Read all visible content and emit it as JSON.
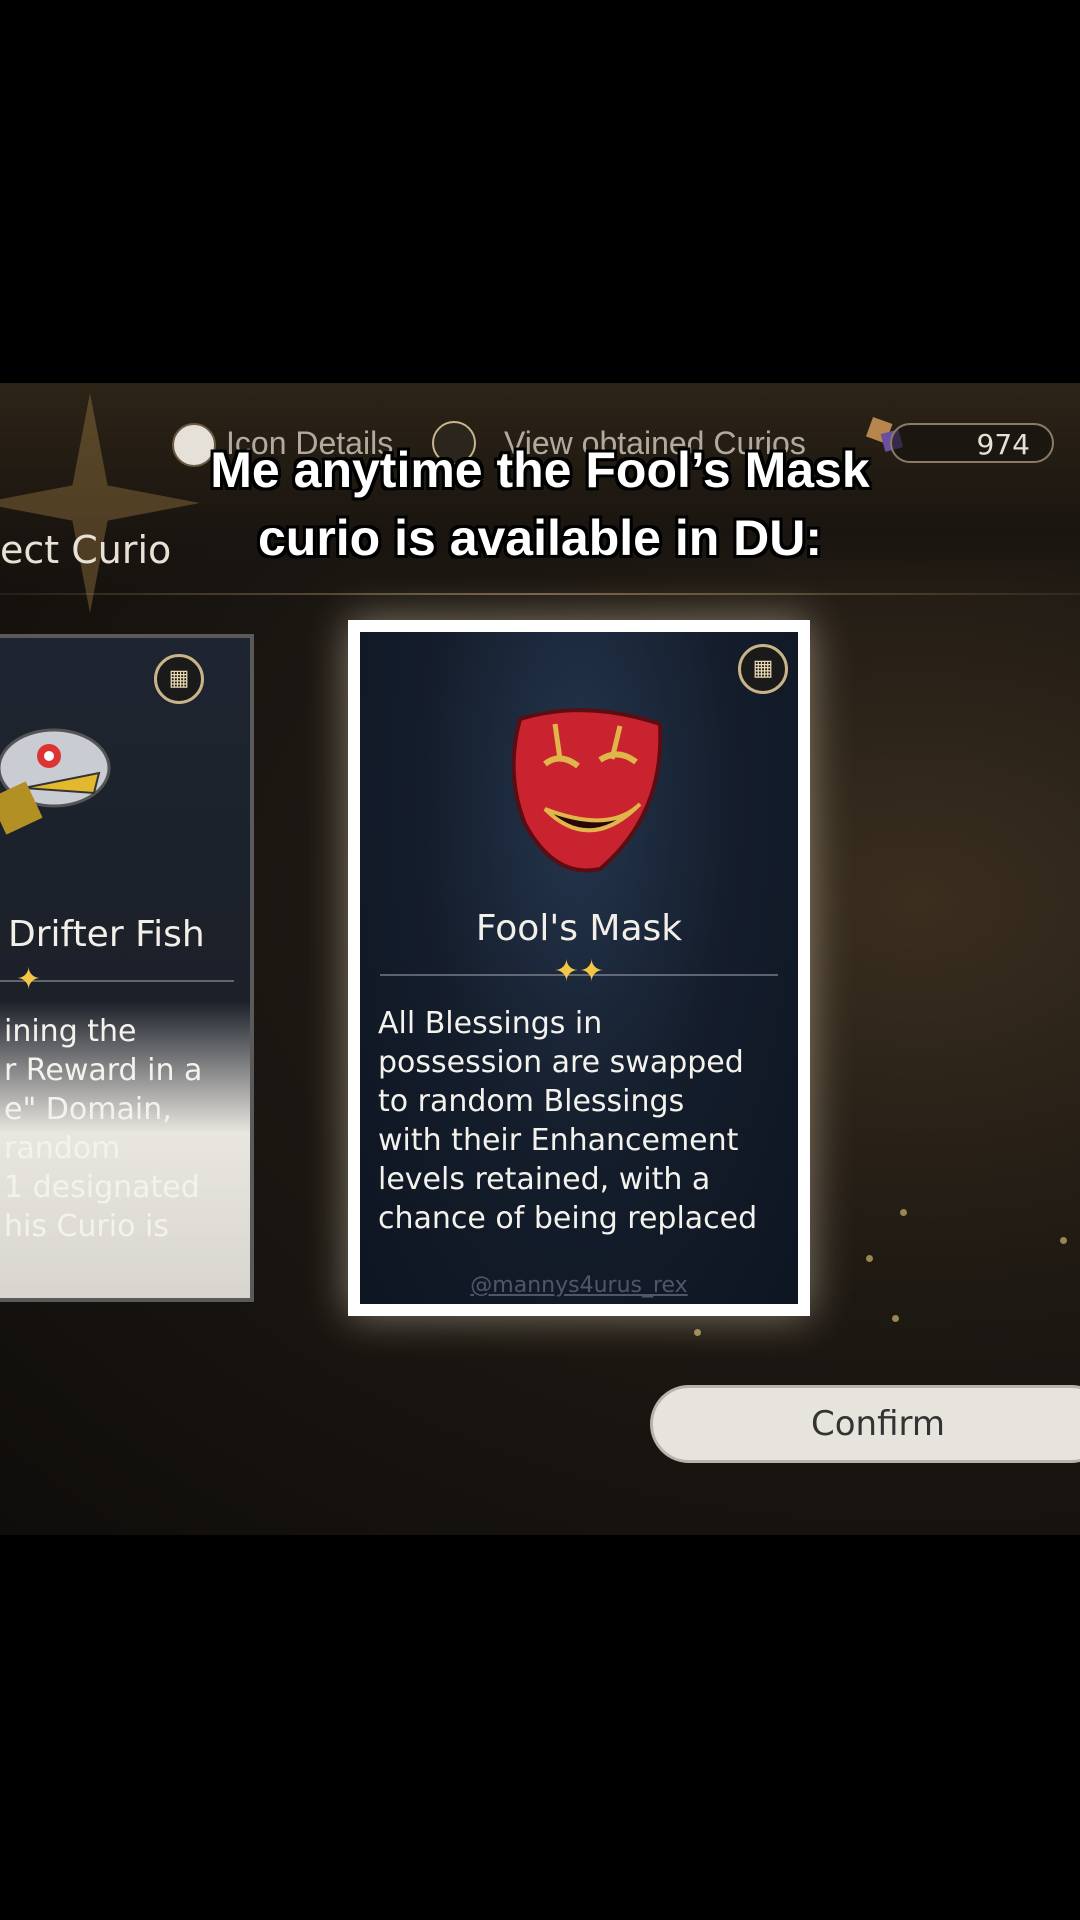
{
  "caption": {
    "line1": "Me anytime the Fool’s Mask",
    "line2": "curio is available in DU:"
  },
  "top_bar": {
    "icon_details_label": "Icon Details",
    "view_curios_label": "View obtained Curios",
    "currency_value": "974",
    "screen_title": "ect Curio"
  },
  "cards": {
    "left": {
      "name": "Drifter Fish",
      "stars": "✦",
      "description": "ining the\nr Reward in a\ne\" Domain,\n random\n 1 designated\nhis Curio is"
    },
    "main": {
      "name": "Fool's Mask",
      "stars": "✦✦",
      "description": "All Blessings in\npossession are swapped\nto random Blessings\nwith their Enhancement\nlevels retained, with a\nchance of being replaced",
      "watermark": "@mannys4urus_rex"
    }
  },
  "confirm_label": "Confirm",
  "colors": {
    "star": "#f3c645",
    "mask": "#c8232f",
    "card_bg": "#141d2b"
  },
  "icons": [
    "info-icon",
    "curio-icon",
    "currency-gem-icon",
    "book-icon",
    "mask-icon",
    "fish-icon"
  ]
}
